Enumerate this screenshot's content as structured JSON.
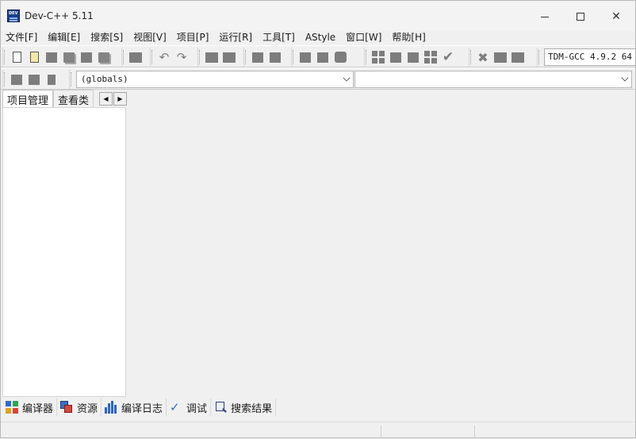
{
  "window": {
    "title": "Dev-C++ 5.11",
    "app_icon_text": "DEV"
  },
  "menu": [
    "文件[F]",
    "编辑[E]",
    "搜索[S]",
    "视图[V]",
    "项目[P]",
    "运行[R]",
    "工具[T]",
    "AStyle",
    "窗口[W]",
    "帮助[H]"
  ],
  "toolbar": {
    "compiler_value": "TDM-GCC 4.9.2 64"
  },
  "class_browser": {
    "scope_value": "(globals)",
    "member_value": ""
  },
  "left_panel": {
    "tabs": [
      "项目管理",
      "查看类"
    ]
  },
  "bottom_tabs": [
    "编译器",
    "资源",
    "编译日志",
    "调试",
    "搜索结果"
  ],
  "colors": {
    "compiler_grid": [
      "#2f6bd0",
      "#30a54e",
      "#e2a11d",
      "#d6463a"
    ]
  }
}
